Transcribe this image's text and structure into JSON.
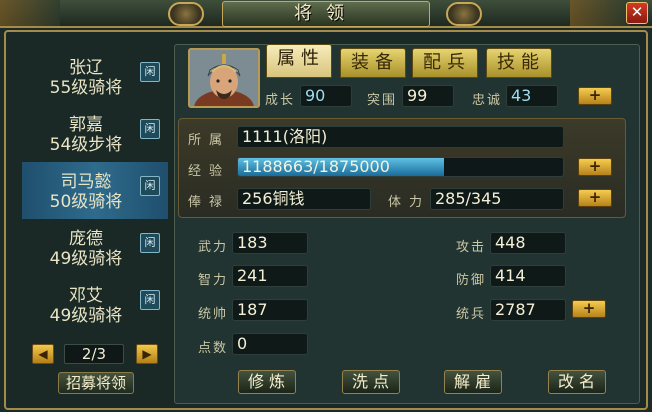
{
  "window": {
    "title": "将领",
    "close_label": "✕"
  },
  "generals": [
    {
      "name": "张辽",
      "info": "55级骑将",
      "tag": "闲"
    },
    {
      "name": "郭嘉",
      "info": "54级步将",
      "tag": "闲"
    },
    {
      "name": "司马懿",
      "info": "50级骑将",
      "tag": "闲"
    },
    {
      "name": "庞德",
      "info": "49级骑将",
      "tag": "闲"
    },
    {
      "name": "邓艾",
      "info": "49级骑将",
      "tag": "闲"
    }
  ],
  "selected_index": 2,
  "pager": {
    "page": "2/3",
    "prev": "◀",
    "next": "▶"
  },
  "recruit_label": "招募将领",
  "tabs": [
    {
      "label": "属性",
      "active": true
    },
    {
      "label": "装备",
      "active": false
    },
    {
      "label": "配兵",
      "active": false
    },
    {
      "label": "技能",
      "active": false
    }
  ],
  "top_stats": {
    "growth_label": "成长",
    "growth": "90",
    "breakout_label": "突围",
    "breakout": "99",
    "loyalty_label": "忠诚",
    "loyalty": "43"
  },
  "info": {
    "belong_label": "所属",
    "belong": "1111(洛阳)",
    "exp_label": "经验",
    "exp": "1188663/1875000",
    "exp_progress": 0.634,
    "salary_label": "俸禄",
    "salary": "256铜钱",
    "stamina_label": "体力",
    "stamina": "285/345"
  },
  "attributes": {
    "force_label": "武力",
    "force": "183",
    "intel_label": "智力",
    "intel": "241",
    "command_label": "统帅",
    "command": "187",
    "points_label": "点数",
    "points": "0",
    "attack_label": "攻击",
    "attack": "448",
    "defense_label": "防御",
    "defense": "414",
    "troops_label": "统兵",
    "troops": "2787"
  },
  "plus_label": "+",
  "actions": {
    "train": "修炼",
    "reset": "洗点",
    "dismiss": "解雇",
    "rename": "改名"
  },
  "colors": {
    "frame_gold": "#a58b4a",
    "selected_row": "#2f6b8c",
    "button_gold": "#f5cd4f",
    "exp_fill": "#5ec0e4"
  }
}
